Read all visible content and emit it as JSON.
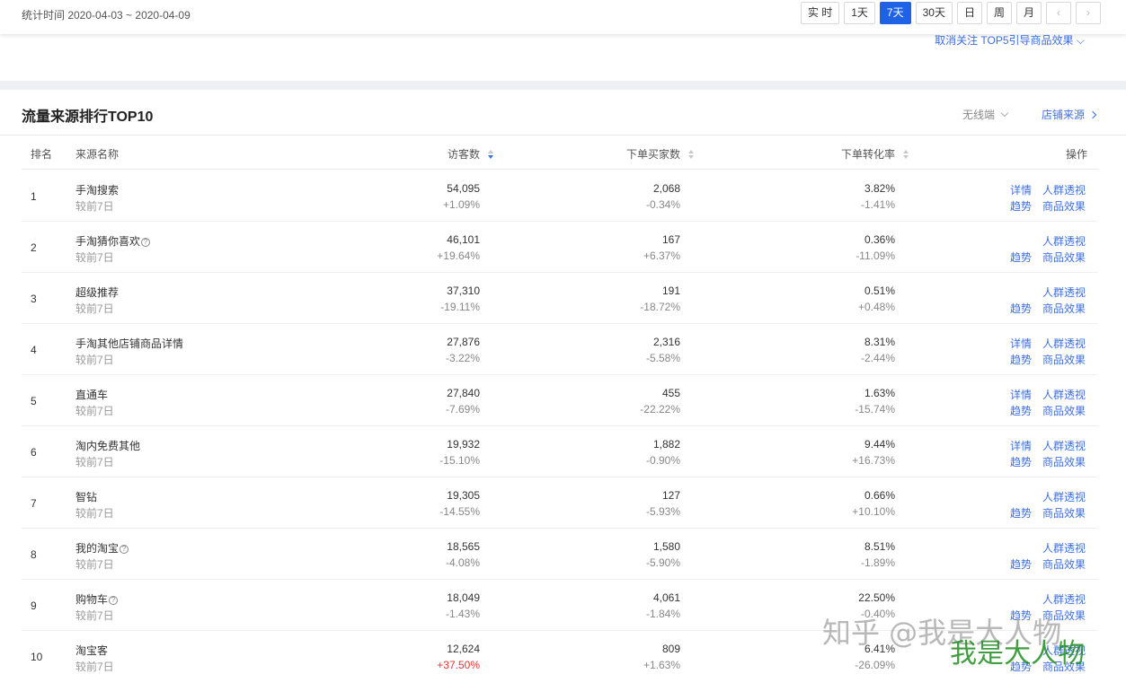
{
  "topbar": {
    "stat_range": "统计时间 2020-04-03 ~ 2020-04-09",
    "periods": [
      {
        "label": "实 时",
        "active": false
      },
      {
        "label": "1天",
        "active": false
      },
      {
        "label": "7天",
        "active": true
      },
      {
        "label": "30天",
        "active": false
      },
      {
        "label": "日",
        "active": false
      },
      {
        "label": "周",
        "active": false
      },
      {
        "label": "月",
        "active": false
      }
    ],
    "prev_icon": "‹",
    "next_icon": "›"
  },
  "panel1": {
    "cancel_link": "取消关注 TOP5引导商品效果"
  },
  "ranking": {
    "title": "流量来源排行TOP10",
    "device_select": "无线端",
    "shop_source_link": "店铺来源",
    "headers": {
      "rank": "排名",
      "source": "来源名称",
      "visitors": "访客数",
      "buyers": "下单买家数",
      "conversion": "下单转化率",
      "actions": "操作"
    },
    "rows": [
      {
        "rank": "1",
        "name": "手淘搜索",
        "sub": "较前7日",
        "help": false,
        "visitors": "54,095",
        "visitors_chg": "+1.09%",
        "buyers": "2,068",
        "buyers_chg": "-0.34%",
        "conv": "3.82%",
        "conv_chg": "-1.41%",
        "detail": true
      },
      {
        "rank": "2",
        "name": "手淘猜你喜欢",
        "sub": "较前7日",
        "help": true,
        "visitors": "46,101",
        "visitors_chg": "+19.64%",
        "buyers": "167",
        "buyers_chg": "+6.37%",
        "conv": "0.36%",
        "conv_chg": "-11.09%",
        "detail": false
      },
      {
        "rank": "3",
        "name": "超级推荐",
        "sub": "较前7日",
        "help": false,
        "visitors": "37,310",
        "visitors_chg": "-19.11%",
        "buyers": "191",
        "buyers_chg": "-18.72%",
        "conv": "0.51%",
        "conv_chg": "+0.48%",
        "detail": false
      },
      {
        "rank": "4",
        "name": "手淘其他店铺商品详情",
        "sub": "较前7日",
        "help": false,
        "visitors": "27,876",
        "visitors_chg": "-3.22%",
        "buyers": "2,316",
        "buyers_chg": "-5.58%",
        "conv": "8.31%",
        "conv_chg": "-2.44%",
        "detail": true
      },
      {
        "rank": "5",
        "name": "直通车",
        "sub": "较前7日",
        "help": false,
        "visitors": "27,840",
        "visitors_chg": "-7.69%",
        "buyers": "455",
        "buyers_chg": "-22.22%",
        "conv": "1.63%",
        "conv_chg": "-15.74%",
        "detail": true
      },
      {
        "rank": "6",
        "name": "淘内免费其他",
        "sub": "较前7日",
        "help": false,
        "visitors": "19,932",
        "visitors_chg": "-15.10%",
        "buyers": "1,882",
        "buyers_chg": "-0.90%",
        "conv": "9.44%",
        "conv_chg": "+16.73%",
        "detail": true
      },
      {
        "rank": "7",
        "name": "智钻",
        "sub": "较前7日",
        "help": false,
        "visitors": "19,305",
        "visitors_chg": "-14.55%",
        "buyers": "127",
        "buyers_chg": "-5.93%",
        "conv": "0.66%",
        "conv_chg": "+10.10%",
        "detail": false
      },
      {
        "rank": "8",
        "name": "我的淘宝",
        "sub": "较前7日",
        "help": true,
        "visitors": "18,565",
        "visitors_chg": "-4.08%",
        "buyers": "1,580",
        "buyers_chg": "-5.90%",
        "conv": "8.51%",
        "conv_chg": "-1.89%",
        "detail": false
      },
      {
        "rank": "9",
        "name": "购物车",
        "sub": "较前7日",
        "help": true,
        "visitors": "18,049",
        "visitors_chg": "-1.43%",
        "buyers": "4,061",
        "buyers_chg": "-1.84%",
        "conv": "22.50%",
        "conv_chg": "-0.40%",
        "detail": false
      },
      {
        "rank": "10",
        "name": "淘宝客",
        "sub": "较前7日",
        "help": false,
        "visitors": "12,624",
        "visitors_chg": "+37.50%",
        "visitors_red": true,
        "buyers": "809",
        "buyers_chg": "+1.63%",
        "conv": "6.41%",
        "conv_chg": "-26.09%",
        "detail": false
      }
    ],
    "action_labels": {
      "detail": "详情",
      "crowd": "人群透视",
      "trend": "趋势",
      "goods": "商品效果"
    }
  },
  "watermark": {
    "text1": "知乎 @我是大人物",
    "text2": "我是大人物"
  },
  "colors": {
    "accent": "#2062e6",
    "link": "#3d6fe0",
    "negative_red": "#e33"
  }
}
